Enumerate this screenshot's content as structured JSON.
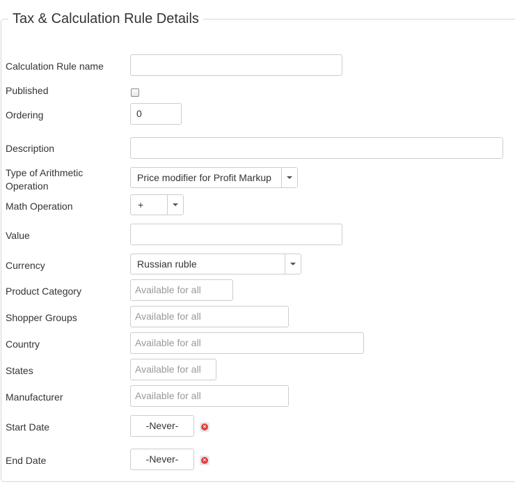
{
  "section_title": "Tax & Calculation Rule Details",
  "fields": {
    "rule_name": {
      "label": "Calculation Rule name",
      "value": ""
    },
    "published": {
      "label": "Published",
      "checked": false
    },
    "ordering": {
      "label": "Ordering",
      "value": "0"
    },
    "description": {
      "label": "Description",
      "value": ""
    },
    "arithmetic_type": {
      "label_line1": "Type of Arithmetic",
      "label_line2": "Operation",
      "selected": "Price modifier for Profit Markup"
    },
    "math_operation": {
      "label": "Math Operation",
      "selected": "+"
    },
    "value": {
      "label": "Value",
      "value": ""
    },
    "currency": {
      "label": "Currency",
      "selected": "Russian ruble"
    },
    "product_category": {
      "label": "Product Category",
      "placeholder": "Available for all"
    },
    "shopper_groups": {
      "label": "Shopper Groups",
      "placeholder": "Available for all"
    },
    "country": {
      "label": "Country",
      "placeholder": "Available for all"
    },
    "states": {
      "label": "States",
      "placeholder": "Available for all"
    },
    "manufacturer": {
      "label": "Manufacturer",
      "placeholder": "Available for all"
    },
    "start_date": {
      "label": "Start Date",
      "value": "-Never-"
    },
    "end_date": {
      "label": "End Date",
      "value": "-Never-"
    }
  },
  "icons": {
    "clear_date": "clear-date-icon",
    "dropdown": "chevron-down-icon"
  }
}
